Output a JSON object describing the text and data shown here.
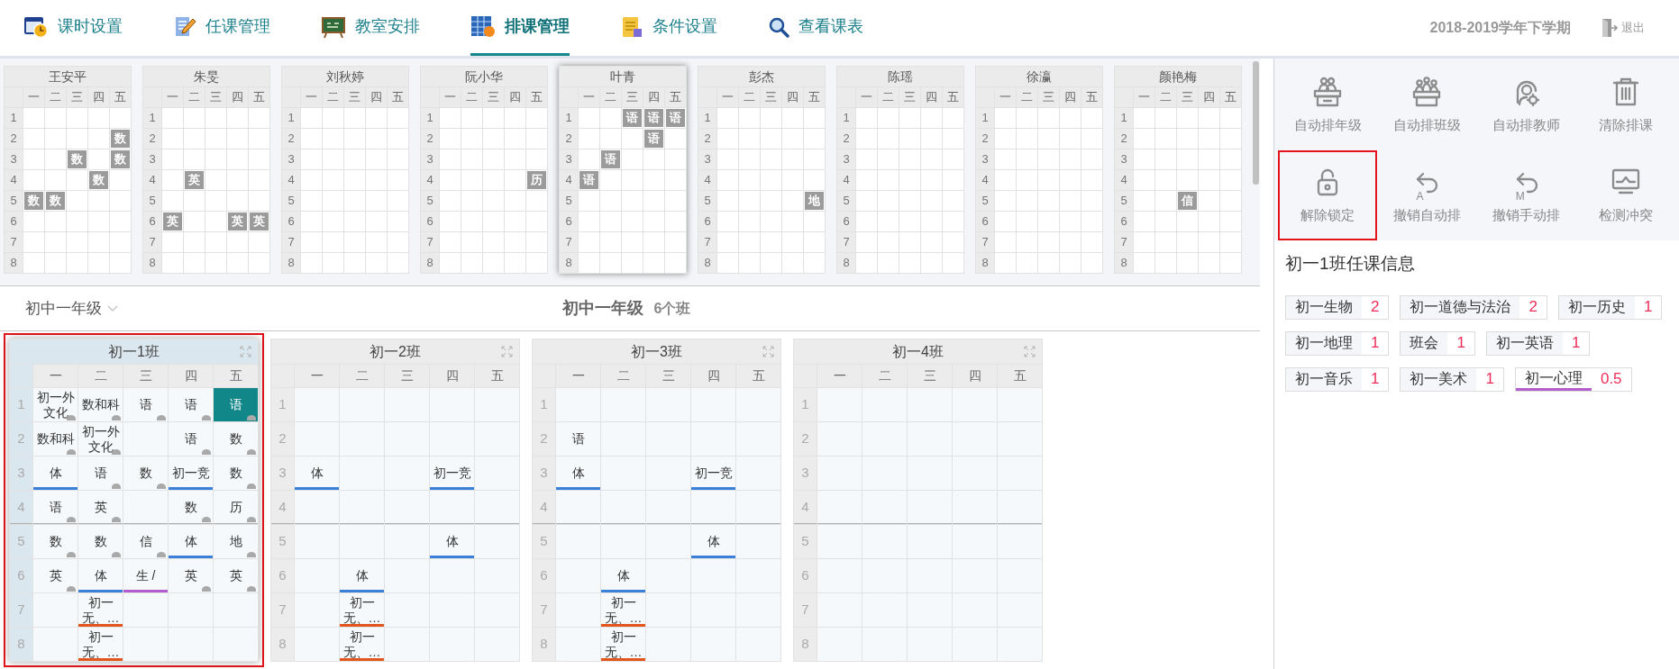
{
  "nav": {
    "tabs": [
      {
        "label": "课时设置",
        "kind": "clock",
        "selected": false
      },
      {
        "label": "任课管理",
        "kind": "pencil",
        "selected": false
      },
      {
        "label": "教室安排",
        "kind": "board",
        "selected": false
      },
      {
        "label": "排课管理",
        "kind": "table",
        "selected": true
      },
      {
        "label": "条件设置",
        "kind": "note",
        "selected": false
      },
      {
        "label": "查看课表",
        "kind": "search",
        "selected": false
      }
    ],
    "term": "2018-2019学年下学期",
    "logout": "退出"
  },
  "teachers": [
    {
      "name": "王安平",
      "selected": false,
      "days": [
        "一",
        "二",
        "三",
        "四",
        "五"
      ],
      "rows": [
        {
          "period": "1",
          "cells": [
            null,
            null,
            null,
            null,
            null
          ]
        },
        {
          "period": "2",
          "cells": [
            null,
            null,
            null,
            null,
            "数"
          ]
        },
        {
          "period": "3",
          "cells": [
            null,
            null,
            "数",
            null,
            "数"
          ]
        },
        {
          "period": "4",
          "cells": [
            null,
            null,
            null,
            "数",
            null
          ]
        },
        {
          "period": "5",
          "cells": [
            "数",
            "数",
            null,
            null,
            null
          ]
        },
        {
          "period": "6",
          "cells": [
            null,
            null,
            null,
            null,
            null
          ]
        },
        {
          "period": "7",
          "cells": [
            null,
            null,
            null,
            null,
            null
          ]
        },
        {
          "period": "8",
          "cells": [
            null,
            null,
            null,
            null,
            null
          ]
        }
      ]
    },
    {
      "name": "朱旻",
      "selected": false,
      "days": [
        "一",
        "二",
        "三",
        "四",
        "五"
      ],
      "rows": [
        {
          "period": "1",
          "cells": [
            null,
            null,
            null,
            null,
            null
          ]
        },
        {
          "period": "2",
          "cells": [
            null,
            null,
            null,
            null,
            null
          ]
        },
        {
          "period": "3",
          "cells": [
            null,
            null,
            null,
            null,
            null
          ]
        },
        {
          "period": "4",
          "cells": [
            null,
            "英",
            null,
            null,
            null
          ]
        },
        {
          "period": "5",
          "cells": [
            null,
            null,
            null,
            null,
            null
          ]
        },
        {
          "period": "6",
          "cells": [
            "英",
            null,
            null,
            "英",
            "英"
          ]
        },
        {
          "period": "7",
          "cells": [
            null,
            null,
            null,
            null,
            null
          ]
        },
        {
          "period": "8",
          "cells": [
            null,
            null,
            null,
            null,
            null
          ]
        }
      ]
    },
    {
      "name": "刘秋婷",
      "selected": false,
      "days": [
        "一",
        "二",
        "三",
        "四",
        "五"
      ],
      "rows": [
        {
          "period": "1",
          "cells": [
            null,
            null,
            null,
            null,
            null
          ]
        },
        {
          "period": "2",
          "cells": [
            null,
            null,
            null,
            null,
            null
          ]
        },
        {
          "period": "3",
          "cells": [
            null,
            null,
            null,
            null,
            null
          ]
        },
        {
          "period": "4",
          "cells": [
            null,
            null,
            null,
            null,
            null
          ]
        },
        {
          "period": "5",
          "cells": [
            null,
            null,
            null,
            null,
            null
          ]
        },
        {
          "period": "6",
          "cells": [
            null,
            null,
            null,
            null,
            null
          ]
        },
        {
          "period": "7",
          "cells": [
            null,
            null,
            null,
            null,
            null
          ]
        },
        {
          "period": "8",
          "cells": [
            null,
            null,
            null,
            null,
            null
          ]
        }
      ]
    },
    {
      "name": "阮小华",
      "selected": false,
      "days": [
        "一",
        "二",
        "三",
        "四",
        "五"
      ],
      "rows": [
        {
          "period": "1",
          "cells": [
            null,
            null,
            null,
            null,
            null
          ]
        },
        {
          "period": "2",
          "cells": [
            null,
            null,
            null,
            null,
            null
          ]
        },
        {
          "period": "3",
          "cells": [
            null,
            null,
            null,
            null,
            null
          ]
        },
        {
          "period": "4",
          "cells": [
            null,
            null,
            null,
            null,
            "历"
          ]
        },
        {
          "period": "5",
          "cells": [
            null,
            null,
            null,
            null,
            null
          ]
        },
        {
          "period": "6",
          "cells": [
            null,
            null,
            null,
            null,
            null
          ]
        },
        {
          "period": "7",
          "cells": [
            null,
            null,
            null,
            null,
            null
          ]
        },
        {
          "period": "8",
          "cells": [
            null,
            null,
            null,
            null,
            null
          ]
        }
      ]
    },
    {
      "name": "叶青",
      "selected": true,
      "days": [
        "一",
        "二",
        "三",
        "四",
        "五"
      ],
      "rows": [
        {
          "period": "1",
          "cells": [
            null,
            null,
            "语",
            "语",
            "语"
          ]
        },
        {
          "period": "2",
          "cells": [
            null,
            null,
            null,
            "语",
            null
          ]
        },
        {
          "period": "3",
          "cells": [
            null,
            "语",
            null,
            null,
            null
          ]
        },
        {
          "period": "4",
          "cells": [
            "语",
            null,
            null,
            null,
            null
          ]
        },
        {
          "period": "5",
          "cells": [
            null,
            null,
            null,
            null,
            null
          ]
        },
        {
          "period": "6",
          "cells": [
            null,
            null,
            null,
            null,
            null
          ]
        },
        {
          "period": "7",
          "cells": [
            null,
            null,
            null,
            null,
            null
          ]
        },
        {
          "period": "8",
          "cells": [
            null,
            null,
            null,
            null,
            null
          ]
        }
      ]
    },
    {
      "name": "彭杰",
      "selected": false,
      "days": [
        "一",
        "二",
        "三",
        "四",
        "五"
      ],
      "rows": [
        {
          "period": "1",
          "cells": [
            null,
            null,
            null,
            null,
            null
          ]
        },
        {
          "period": "2",
          "cells": [
            null,
            null,
            null,
            null,
            null
          ]
        },
        {
          "period": "3",
          "cells": [
            null,
            null,
            null,
            null,
            null
          ]
        },
        {
          "period": "4",
          "cells": [
            null,
            null,
            null,
            null,
            null
          ]
        },
        {
          "period": "5",
          "cells": [
            null,
            null,
            null,
            null,
            "地"
          ]
        },
        {
          "period": "6",
          "cells": [
            null,
            null,
            null,
            null,
            null
          ]
        },
        {
          "period": "7",
          "cells": [
            null,
            null,
            null,
            null,
            null
          ]
        },
        {
          "period": "8",
          "cells": [
            null,
            null,
            null,
            null,
            null
          ]
        }
      ]
    },
    {
      "name": "陈瑶",
      "selected": false,
      "days": [
        "一",
        "二",
        "三",
        "四",
        "五"
      ],
      "rows": [
        {
          "period": "1",
          "cells": [
            null,
            null,
            null,
            null,
            null
          ]
        },
        {
          "period": "2",
          "cells": [
            null,
            null,
            null,
            null,
            null
          ]
        },
        {
          "period": "3",
          "cells": [
            null,
            null,
            null,
            null,
            null
          ]
        },
        {
          "period": "4",
          "cells": [
            null,
            null,
            null,
            null,
            null
          ]
        },
        {
          "period": "5",
          "cells": [
            null,
            null,
            null,
            null,
            null
          ]
        },
        {
          "period": "6",
          "cells": [
            null,
            null,
            null,
            null,
            null
          ]
        },
        {
          "period": "7",
          "cells": [
            null,
            null,
            null,
            null,
            null
          ]
        },
        {
          "period": "8",
          "cells": [
            null,
            null,
            null,
            null,
            null
          ]
        }
      ]
    },
    {
      "name": "徐瀛",
      "selected": false,
      "days": [
        "一",
        "二",
        "三",
        "四",
        "五"
      ],
      "rows": [
        {
          "period": "1",
          "cells": [
            null,
            null,
            null,
            null,
            null
          ]
        },
        {
          "period": "2",
          "cells": [
            null,
            null,
            null,
            null,
            null
          ]
        },
        {
          "period": "3",
          "cells": [
            null,
            null,
            null,
            null,
            null
          ]
        },
        {
          "period": "4",
          "cells": [
            null,
            null,
            null,
            null,
            null
          ]
        },
        {
          "period": "5",
          "cells": [
            null,
            null,
            null,
            null,
            null
          ]
        },
        {
          "period": "6",
          "cells": [
            null,
            null,
            null,
            null,
            null
          ]
        },
        {
          "period": "7",
          "cells": [
            null,
            null,
            null,
            null,
            null
          ]
        },
        {
          "period": "8",
          "cells": [
            null,
            null,
            null,
            null,
            null
          ]
        }
      ]
    },
    {
      "name": "颜艳梅",
      "selected": false,
      "days": [
        "一",
        "二",
        "三",
        "四",
        "五"
      ],
      "rows": [
        {
          "period": "1",
          "cells": [
            null,
            null,
            null,
            null,
            null
          ]
        },
        {
          "period": "2",
          "cells": [
            null,
            null,
            null,
            null,
            null
          ]
        },
        {
          "period": "3",
          "cells": [
            null,
            null,
            null,
            null,
            null
          ]
        },
        {
          "period": "4",
          "cells": [
            null,
            null,
            null,
            null,
            null
          ]
        },
        {
          "period": "5",
          "cells": [
            null,
            null,
            "信",
            null,
            null
          ]
        },
        {
          "period": "6",
          "cells": [
            null,
            null,
            null,
            null,
            null
          ]
        },
        {
          "period": "7",
          "cells": [
            null,
            null,
            null,
            null,
            null
          ]
        },
        {
          "period": "8",
          "cells": [
            null,
            null,
            null,
            null,
            null
          ]
        }
      ]
    }
  ],
  "grade_selector": "初中一年级",
  "grade_title": "初中一年级",
  "class_count": "6个班",
  "classes": [
    {
      "name": "初一1班",
      "selected": true,
      "annotated": true,
      "days": [
        "一",
        "二",
        "三",
        "四",
        "五"
      ],
      "rows": [
        {
          "period": "1",
          "cells": [
            {
              "text": "初一外文化",
              "locked": true,
              "selected": false
            },
            {
              "text": "数和科",
              "locked": true,
              "selected": false
            },
            {
              "text": "语",
              "locked": true,
              "selected": false
            },
            {
              "text": "语",
              "locked": true,
              "selected": false
            },
            {
              "text": "语",
              "locked": true,
              "selected": true
            }
          ]
        },
        {
          "period": "2",
          "cells": [
            {
              "text": "数和科",
              "locked": true,
              "selected": false
            },
            {
              "text": "初一外文化",
              "locked": true,
              "selected": false
            },
            null,
            {
              "text": "语",
              "locked": true,
              "selected": false
            },
            {
              "text": "数",
              "locked": true,
              "selected": false
            }
          ]
        },
        {
          "period": "3",
          "cells": [
            {
              "text": "体",
              "locked": false,
              "selected": false,
              "color": "#3a80d9"
            },
            {
              "text": "语",
              "locked": true,
              "selected": false
            },
            {
              "text": "数",
              "locked": true,
              "selected": false
            },
            {
              "text": "初一竞",
              "locked": false,
              "selected": false,
              "color": "#3a80d9"
            },
            {
              "text": "数",
              "locked": true,
              "selected": false
            }
          ]
        },
        {
          "period": "4",
          "cells": [
            {
              "text": "语",
              "locked": true,
              "selected": false
            },
            {
              "text": "英",
              "locked": true,
              "selected": false
            },
            null,
            {
              "text": "数",
              "locked": true,
              "selected": false
            },
            {
              "text": "历",
              "locked": true,
              "selected": false
            }
          ]
        },
        {
          "period": "5",
          "cells": [
            {
              "text": "数",
              "locked": true,
              "selected": false
            },
            {
              "text": "数",
              "locked": true,
              "selected": false
            },
            {
              "text": "信",
              "locked": true,
              "selected": false
            },
            {
              "text": "体",
              "locked": false,
              "selected": false,
              "color": "#3a80d9"
            },
            {
              "text": "地",
              "locked": true,
              "selected": false
            }
          ]
        },
        {
          "period": "6",
          "cells": [
            {
              "text": "英",
              "locked": true,
              "selected": false
            },
            {
              "text": "体",
              "locked": false,
              "selected": false,
              "color": "#3a80d9"
            },
            {
              "text": "生 /",
              "locked": false,
              "selected": false,
              "color": "#b45dcf"
            },
            {
              "text": "英",
              "locked": true,
              "selected": false
            },
            {
              "text": "英",
              "locked": true,
              "selected": false
            }
          ]
        },
        {
          "period": "7",
          "cells": [
            null,
            {
              "text": "初一无、…",
              "locked": false,
              "selected": false,
              "color": "#e3561b"
            },
            null,
            null,
            null
          ]
        },
        {
          "period": "8",
          "cells": [
            null,
            {
              "text": "初一无、…",
              "locked": false,
              "selected": false,
              "color": "#e3561b"
            },
            null,
            null,
            null
          ]
        }
      ]
    },
    {
      "name": "初一2班",
      "selected": false,
      "annotated": false,
      "days": [
        "一",
        "二",
        "三",
        "四",
        "五"
      ],
      "rows": [
        {
          "period": "1",
          "cells": [
            null,
            null,
            null,
            null,
            null
          ]
        },
        {
          "period": "2",
          "cells": [
            null,
            null,
            null,
            null,
            null
          ]
        },
        {
          "period": "3",
          "cells": [
            {
              "text": "体",
              "locked": false,
              "selected": false,
              "color": "#3a80d9"
            },
            null,
            null,
            {
              "text": "初一竞",
              "locked": false,
              "selected": false,
              "color": "#3a80d9"
            },
            null
          ]
        },
        {
          "period": "4",
          "cells": [
            null,
            null,
            null,
            null,
            null
          ]
        },
        {
          "period": "5",
          "cells": [
            null,
            null,
            null,
            {
              "text": "体",
              "locked": false,
              "selected": false,
              "color": "#3a80d9"
            },
            null
          ]
        },
        {
          "period": "6",
          "cells": [
            null,
            {
              "text": "体",
              "locked": false,
              "selected": false,
              "color": "#3a80d9"
            },
            null,
            null,
            null
          ]
        },
        {
          "period": "7",
          "cells": [
            null,
            {
              "text": "初一无、…",
              "locked": false,
              "selected": false,
              "color": "#e3561b"
            },
            null,
            null,
            null
          ]
        },
        {
          "period": "8",
          "cells": [
            null,
            {
              "text": "初一无、…",
              "locked": false,
              "selected": false,
              "color": "#e3561b"
            },
            null,
            null,
            null
          ]
        }
      ]
    },
    {
      "name": "初一3班",
      "selected": false,
      "annotated": false,
      "days": [
        "一",
        "二",
        "三",
        "四",
        "五"
      ],
      "rows": [
        {
          "period": "1",
          "cells": [
            null,
            null,
            null,
            null,
            null
          ]
        },
        {
          "period": "2",
          "cells": [
            {
              "text": "语",
              "locked": false,
              "selected": false
            },
            null,
            null,
            null,
            null
          ]
        },
        {
          "period": "3",
          "cells": [
            {
              "text": "体",
              "locked": false,
              "selected": false,
              "color": "#3a80d9"
            },
            null,
            null,
            {
              "text": "初一竞",
              "locked": false,
              "selected": false,
              "color": "#3a80d9"
            },
            null
          ]
        },
        {
          "period": "4",
          "cells": [
            null,
            null,
            null,
            null,
            null
          ]
        },
        {
          "period": "5",
          "cells": [
            null,
            null,
            null,
            {
              "text": "体",
              "locked": false,
              "selected": false,
              "color": "#3a80d9"
            },
            null
          ]
        },
        {
          "period": "6",
          "cells": [
            null,
            {
              "text": "体",
              "locked": false,
              "selected": false,
              "color": "#3a80d9"
            },
            null,
            null,
            null
          ]
        },
        {
          "period": "7",
          "cells": [
            null,
            {
              "text": "初一无、…",
              "locked": false,
              "selected": false,
              "color": "#e3561b"
            },
            null,
            null,
            null
          ]
        },
        {
          "period": "8",
          "cells": [
            null,
            {
              "text": "初一无、…",
              "locked": false,
              "selected": false,
              "color": "#e3561b"
            },
            null,
            null,
            null
          ]
        }
      ]
    },
    {
      "name": "初一4班",
      "selected": false,
      "annotated": false,
      "days": [
        "一",
        "二",
        "三",
        "四",
        "五"
      ],
      "rows": [
        {
          "period": "1",
          "cells": [
            null,
            null,
            null,
            null,
            null
          ]
        },
        {
          "period": "2",
          "cells": [
            null,
            null,
            null,
            null,
            null
          ]
        },
        {
          "period": "3",
          "cells": [
            null,
            null,
            null,
            null,
            null
          ]
        },
        {
          "period": "4",
          "cells": [
            null,
            null,
            null,
            null,
            null
          ]
        },
        {
          "period": "5",
          "cells": [
            null,
            null,
            null,
            null,
            null
          ]
        },
        {
          "period": "6",
          "cells": [
            null,
            null,
            null,
            null,
            null
          ]
        },
        {
          "period": "7",
          "cells": [
            null,
            null,
            null,
            null,
            null
          ]
        },
        {
          "period": "8",
          "cells": [
            null,
            null,
            null,
            null,
            null
          ]
        }
      ]
    }
  ],
  "actions": [
    {
      "label": "自动排年级",
      "kind": "grade",
      "annotated": false
    },
    {
      "label": "自动排班级",
      "kind": "class",
      "annotated": false
    },
    {
      "label": "自动排教师",
      "kind": "teacher",
      "annotated": false
    },
    {
      "label": "清除排课",
      "kind": "clear",
      "annotated": false
    },
    {
      "label": "解除锁定",
      "kind": "unlock",
      "annotated": true
    },
    {
      "label": "撤销自动排",
      "kind": "undo",
      "icon_letter": "A",
      "annotated": false
    },
    {
      "label": "撤销手动排",
      "kind": "undo",
      "icon_letter": "M",
      "annotated": false
    },
    {
      "label": "检测冲突",
      "kind": "monitor",
      "annotated": false
    }
  ],
  "course_info": {
    "title": "初一1班任课信息",
    "courses": [
      {
        "name": "初一生物",
        "count": "2"
      },
      {
        "name": "初一道德与法治",
        "count": "2"
      },
      {
        "name": "初一历史",
        "count": "1"
      },
      {
        "name": "初一地理",
        "count": "1"
      },
      {
        "name": "班会",
        "count": "1"
      },
      {
        "name": "初一英语",
        "count": "1"
      },
      {
        "name": "初一音乐",
        "count": "1"
      },
      {
        "name": "初一美术",
        "count": "1"
      },
      {
        "name": "初一心理",
        "count": "0.5",
        "color": "#b45dcf"
      }
    ]
  }
}
